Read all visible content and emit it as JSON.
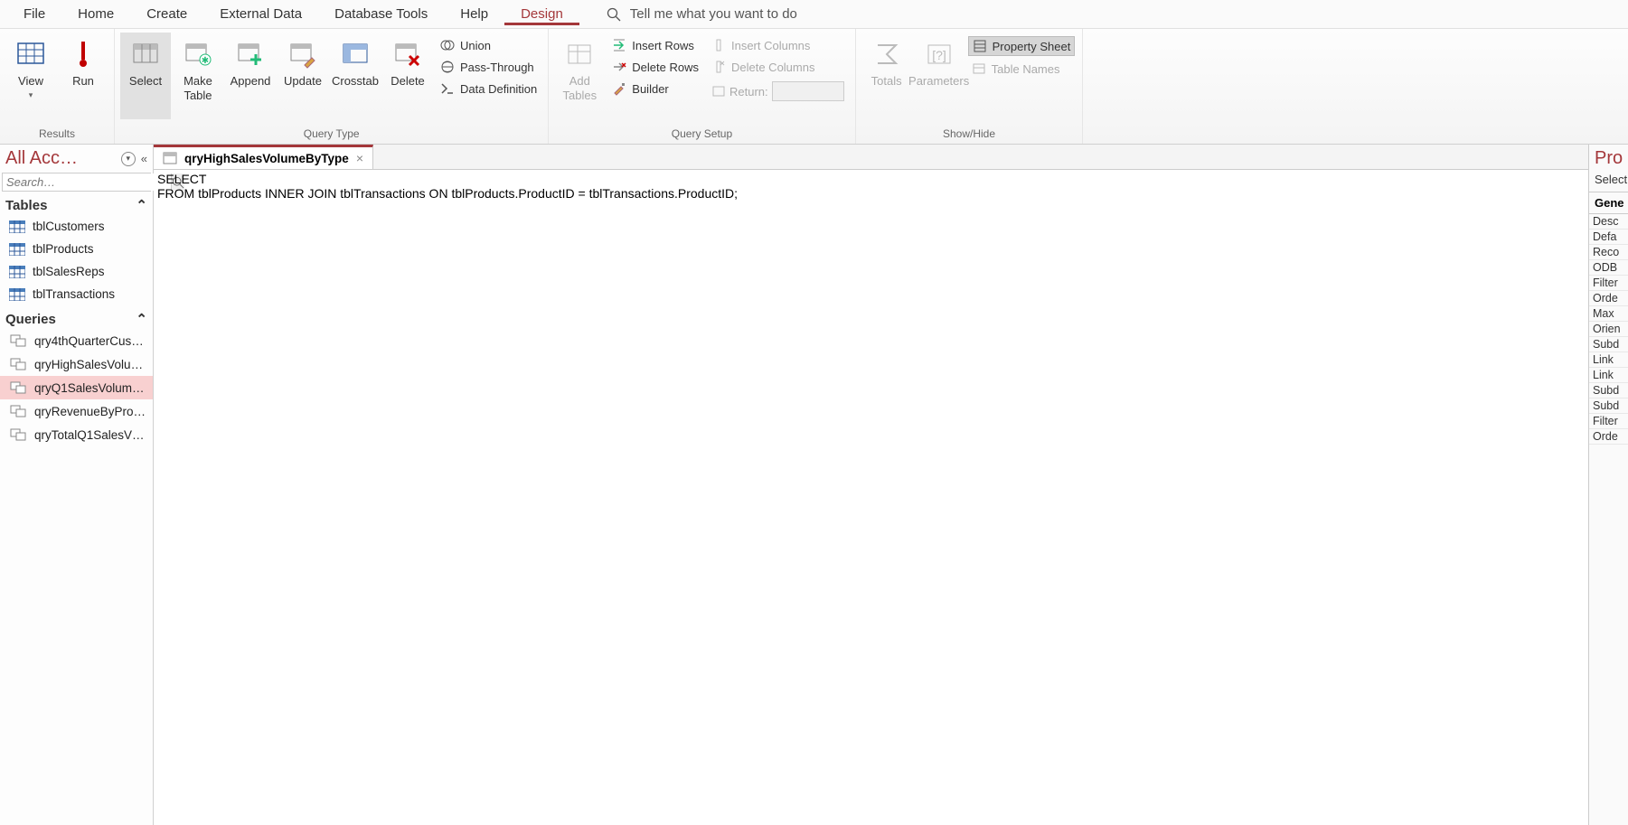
{
  "ribbonTabs": {
    "file": "File",
    "home": "Home",
    "create": "Create",
    "externalData": "External Data",
    "databaseTools": "Database Tools",
    "help": "Help",
    "design": "Design",
    "tellMe": "Tell me what you want to do"
  },
  "ribbon": {
    "results": {
      "label": "Results",
      "view": "View",
      "run": "Run"
    },
    "queryType": {
      "label": "Query Type",
      "select": "Select",
      "makeTable": "Make\nTable",
      "append": "Append",
      "update": "Update",
      "crosstab": "Crosstab",
      "delete": "Delete",
      "union": "Union",
      "passThrough": "Pass-Through",
      "dataDefinition": "Data Definition"
    },
    "querySetup": {
      "label": "Query Setup",
      "addTables": "Add\nTables",
      "insertRows": "Insert Rows",
      "deleteRows": "Delete Rows",
      "builder": "Builder",
      "insertColumns": "Insert Columns",
      "deleteColumns": "Delete Columns",
      "return": "Return:"
    },
    "showHide": {
      "label": "Show/Hide",
      "totals": "Totals",
      "parameters": "Parameters",
      "propertySheet": "Property Sheet",
      "tableNames": "Table Names"
    }
  },
  "nav": {
    "title": "All Acc…",
    "searchPlaceholder": "Search…",
    "tablesHeader": "Tables",
    "queriesHeader": "Queries",
    "tables": {
      "t0": "tblCustomers",
      "t1": "tblProducts",
      "t2": "tblSalesReps",
      "t3": "tblTransactions"
    },
    "queries": {
      "q0": "qry4thQuarterCus…",
      "q1": "qryHighSalesVolu…",
      "q2": "qryQ1SalesVolum…",
      "q3": "qryRevenueByPro…",
      "q4": "qryTotalQ1SalesV…"
    }
  },
  "docTab": {
    "title": "qryHighSalesVolumeByType"
  },
  "sql": {
    "line1": "SELECT ",
    "line2": "FROM tblProducts INNER JOIN tblTransactions ON tblProducts.ProductID = tblTransactions.ProductID;"
  },
  "propSheet": {
    "title": "Pro",
    "subtitle": "Select",
    "tab": "Gene",
    "rows": {
      "r0": "Desc",
      "r1": "Defa",
      "r2": "Reco",
      "r3": "ODB",
      "r4": "Filter",
      "r5": "Orde",
      "r6": "Max",
      "r7": "Orien",
      "r8": "Subd",
      "r9": "Link",
      "r10": "Link",
      "r11": "Subd",
      "r12": "Subd",
      "r13": "Filter",
      "r14": "Orde"
    }
  }
}
